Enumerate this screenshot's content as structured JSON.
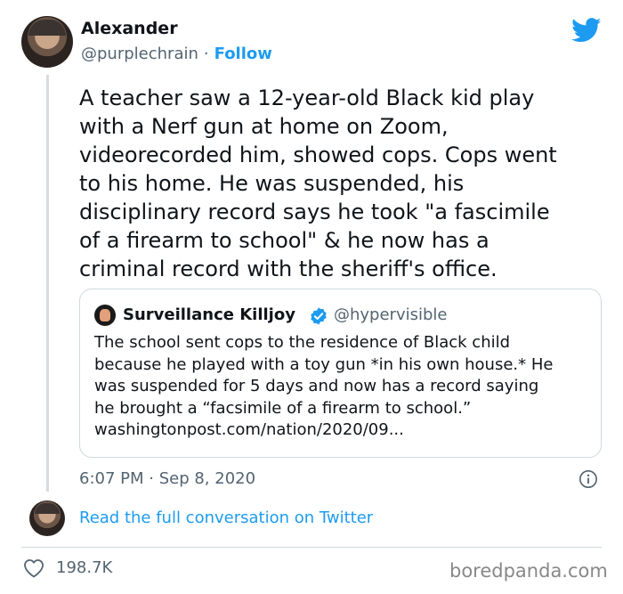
{
  "author": {
    "name": "Alexander",
    "handle": "@purplechrain",
    "separator": "·",
    "follow_label": "Follow"
  },
  "tweet": {
    "text": "A teacher saw a 12-year-old Black kid play\nwith a Nerf gun at home on Zoom,\nvideorecorded him, showed cops. Cops went\nto his home. He was suspended, his\ndisciplinary record says he took \"a fascimile\nof a firearm to school\" & he now has a\ncriminal record with the sheriff's office.",
    "timestamp": "6:07 PM · Sep 8, 2020"
  },
  "quoted_tweet": {
    "name": "Surveillance Killjoy",
    "handle": "@hypervisible",
    "text": "The school sent cops to the residence of Black child\nbecause he played with a toy gun *in his own house.* He\nwas suspended for 5 days and now has a record saying\nhe brought a “facsimile of a firearm to school.”\nwashingtonpost.com/nation/2020/09..."
  },
  "footer": {
    "read_more_label": "Read the full conversation on Twitter",
    "likes_count": "198.7K",
    "watermark": "boredpanda.com"
  },
  "icons": {
    "brand": "twitter-bird-icon",
    "verified": "verified-icon",
    "info": "info-icon",
    "like": "heart-icon"
  },
  "colors": {
    "accent": "#1d9bf0",
    "text": "#0f1419",
    "secondary": "#536471",
    "border": "#cfd9de"
  }
}
